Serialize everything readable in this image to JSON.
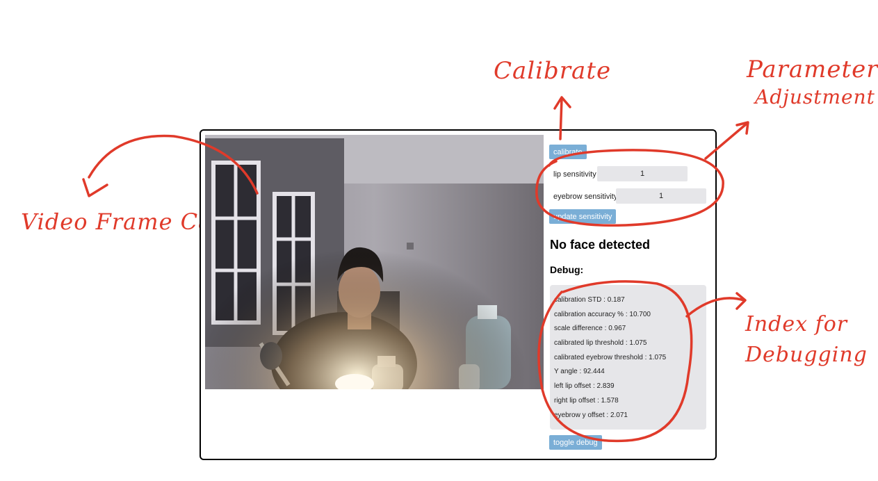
{
  "annotations": {
    "calibrate": "Calibrate",
    "parameters_line1": "Parameters",
    "parameters_line2": "Adjustment",
    "video": "Video Frame Capture",
    "debug_line1": "Index for",
    "debug_line2": "Debugging",
    "color": "#e03a2a"
  },
  "controls": {
    "calibrate_label": "calibrate",
    "lip_label": "lip sensitivity",
    "lip_value": "1",
    "eyebrow_label": "eyebrow sensitivity",
    "eyebrow_value": "1",
    "update_label": "update sensitivity",
    "toggle_debug_label": "toggle debug",
    "button_color": "#7aaed6"
  },
  "status": {
    "face_status": "No face detected",
    "debug_heading": "Debug:"
  },
  "debug": [
    "calibration STD : 0.187",
    "calibration accuracy % : 10.700",
    "scale difference : 0.967",
    "calibrated lip threshold : 1.075",
    "calibrated eyebrow threshold : 1.075",
    "Y angle : 92.444",
    "left lip offset : 2.839",
    "right lip offset : 1.578",
    "eyebrow y offset : 2.071"
  ]
}
